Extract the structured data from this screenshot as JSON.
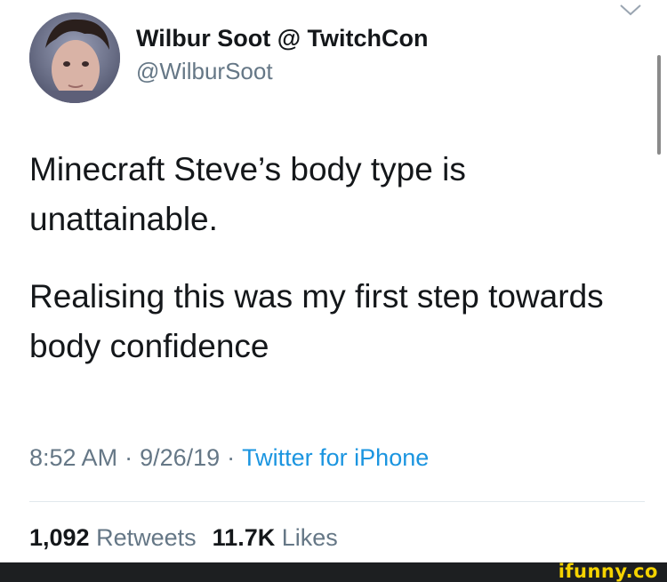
{
  "author": {
    "display_name": "Wilbur Soot @ TwitchCon",
    "handle": "@WilburSoot",
    "avatar_icon": "profile-photo"
  },
  "tweet": {
    "paragraphs": [
      "Minecraft Steve’s body type is unattainable.",
      "Realising this was my first step towards body confidence"
    ],
    "time": "8:52 AM",
    "date": "9/26/19",
    "separator": "·",
    "source": "Twitter for iPhone"
  },
  "stats": {
    "retweets_count": "1,092",
    "retweets_label": "Retweets",
    "likes_count": "11.7K",
    "likes_label": "Likes"
  },
  "watermark": {
    "text": "ifunny.co",
    "color": "#f5d300"
  },
  "colors": {
    "link": "#1b95e0",
    "secondary_text": "#657786"
  }
}
